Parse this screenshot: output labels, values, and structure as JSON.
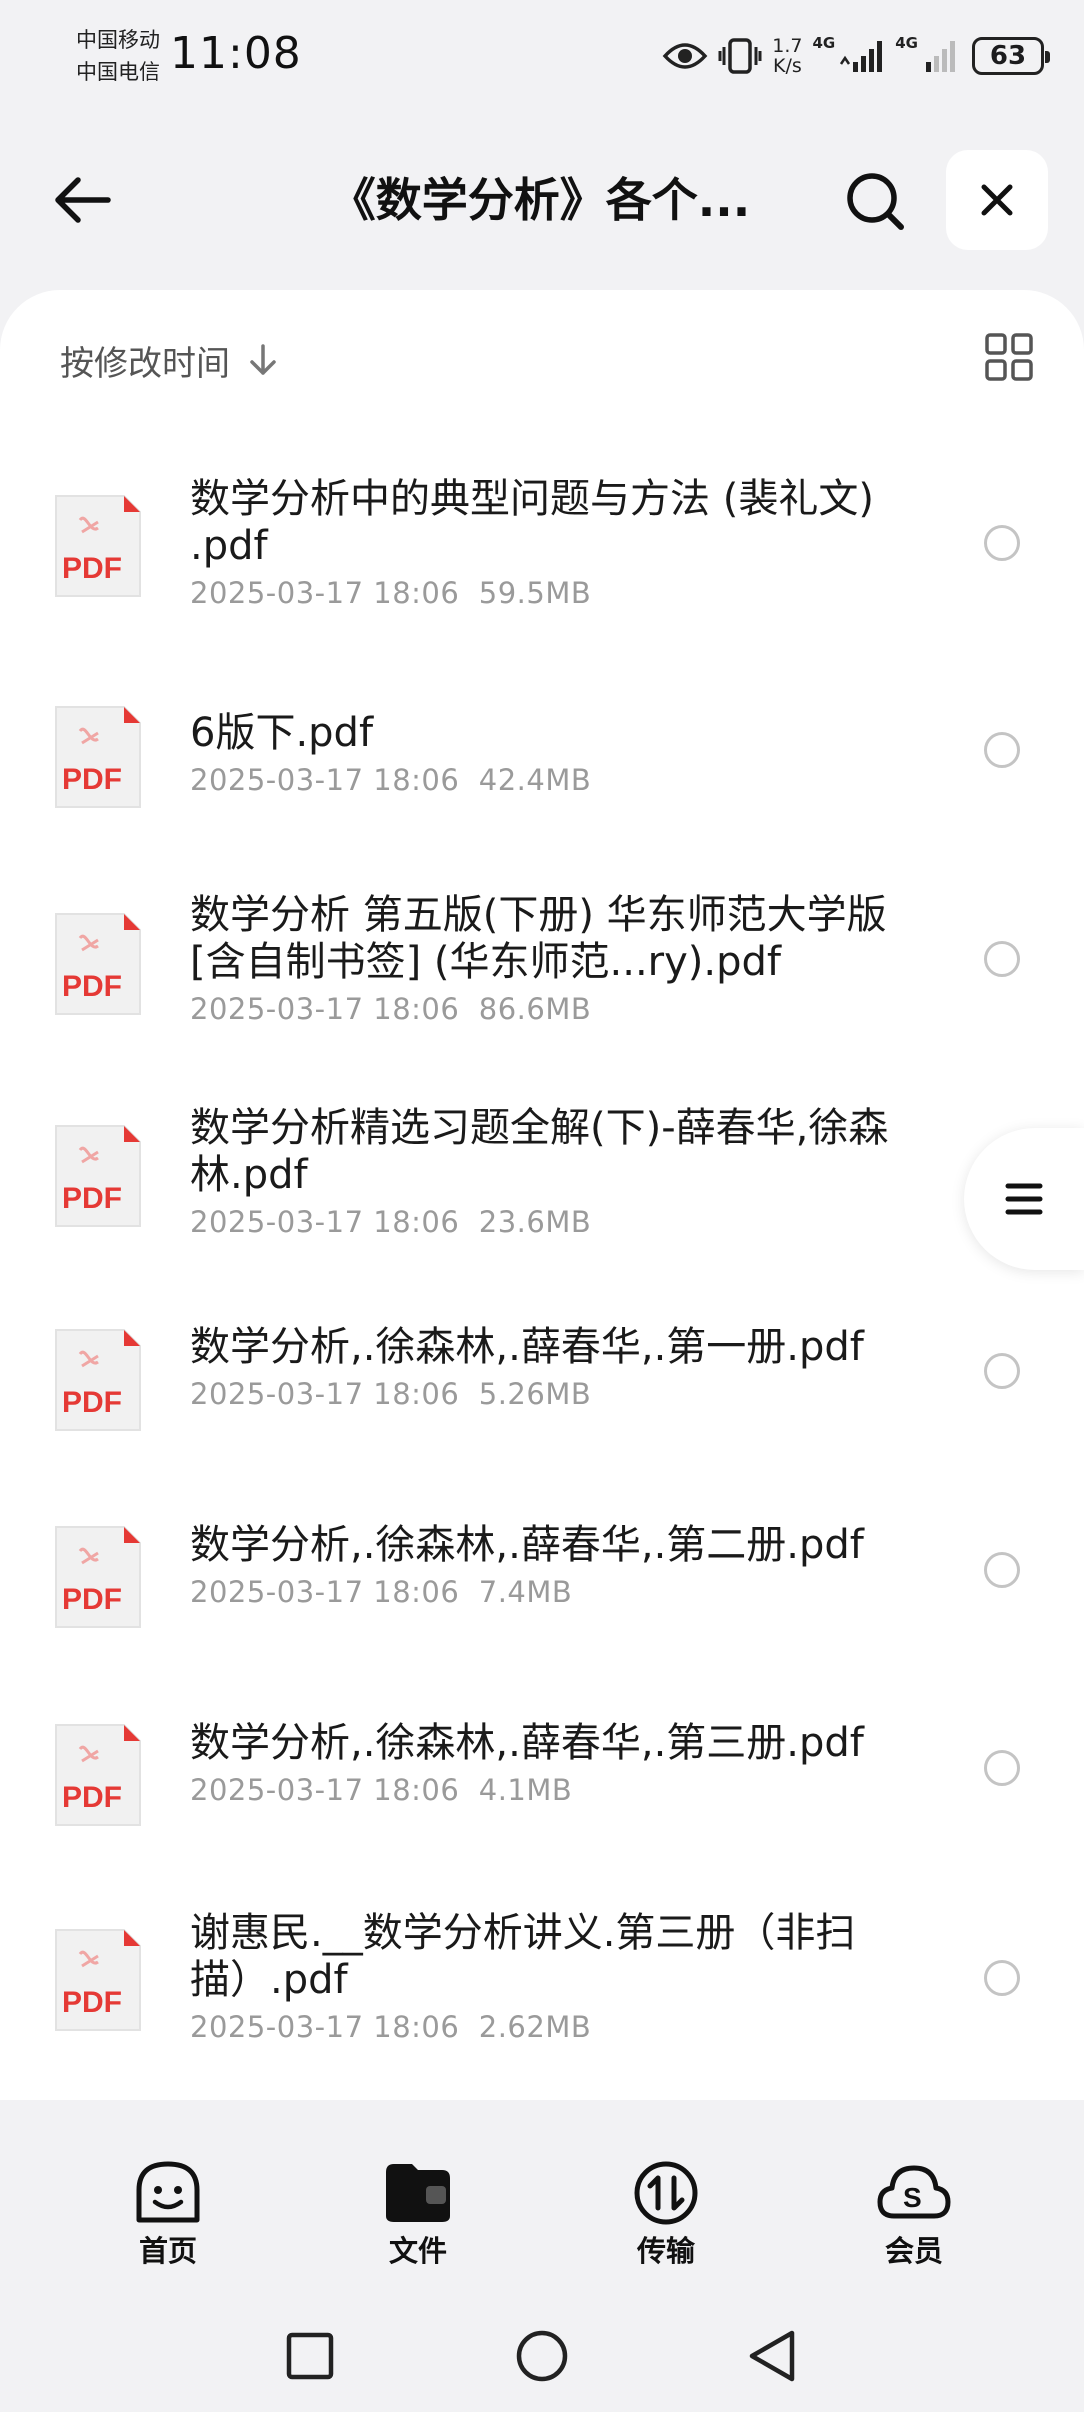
{
  "status_bar": {
    "carrier_1": "中国移动",
    "carrier_2": "中国电信",
    "time": "11:08",
    "net_speed_value": "1.7",
    "net_speed_unit": "K/s",
    "signal_1_label": "4G",
    "signal_2_label": "4G",
    "battery_level": "63"
  },
  "header": {
    "title": "《数学分析》各个..."
  },
  "sort_bar": {
    "label": "按修改时间"
  },
  "files": [
    {
      "name": "数学分析中的典型问题与方法 (裴礼文) .pdf",
      "date": "2025-03-17 18:06",
      "size": "59.5MB",
      "icon_label": "PDF"
    },
    {
      "name": "6版下.pdf",
      "date": "2025-03-17 18:06",
      "size": "42.4MB",
      "icon_label": "PDF"
    },
    {
      "name": "数学分析 第五版(下册) 华东师范大学版 [含自制书签] (华东师范...ry).pdf",
      "date": "2025-03-17 18:06",
      "size": "86.6MB",
      "icon_label": "PDF"
    },
    {
      "name": "数学分析精选习题全解(下)-薛春华,徐森林.pdf",
      "date": "2025-03-17 18:06",
      "size": "23.6MB",
      "icon_label": "PDF"
    },
    {
      "name": "数学分析,.徐森林,.薛春华,.第一册.pdf",
      "date": "2025-03-17 18:06",
      "size": "5.26MB",
      "icon_label": "PDF"
    },
    {
      "name": "数学分析,.徐森林,.薛春华,.第二册.pdf",
      "date": "2025-03-17 18:06",
      "size": "7.4MB",
      "icon_label": "PDF"
    },
    {
      "name": "数学分析,.徐森林,.薛春华,.第三册.pdf",
      "date": "2025-03-17 18:06",
      "size": "4.1MB",
      "icon_label": "PDF"
    },
    {
      "name": "谢惠民.__数学分析讲义.第三册（非扫描）.pdf",
      "date": "2025-03-17 18:06",
      "size": "2.62MB",
      "icon_label": "PDF"
    }
  ],
  "bottom_nav": {
    "items": [
      {
        "label": "首页",
        "icon": "smile-home-icon"
      },
      {
        "label": "文件",
        "icon": "folder-icon"
      },
      {
        "label": "传输",
        "icon": "transfer-icon"
      },
      {
        "label": "会员",
        "icon": "cloud-member-icon"
      }
    ]
  },
  "colors": {
    "pdf_red": "#e53935",
    "background": "#f2f2f4",
    "card": "#ffffff"
  }
}
